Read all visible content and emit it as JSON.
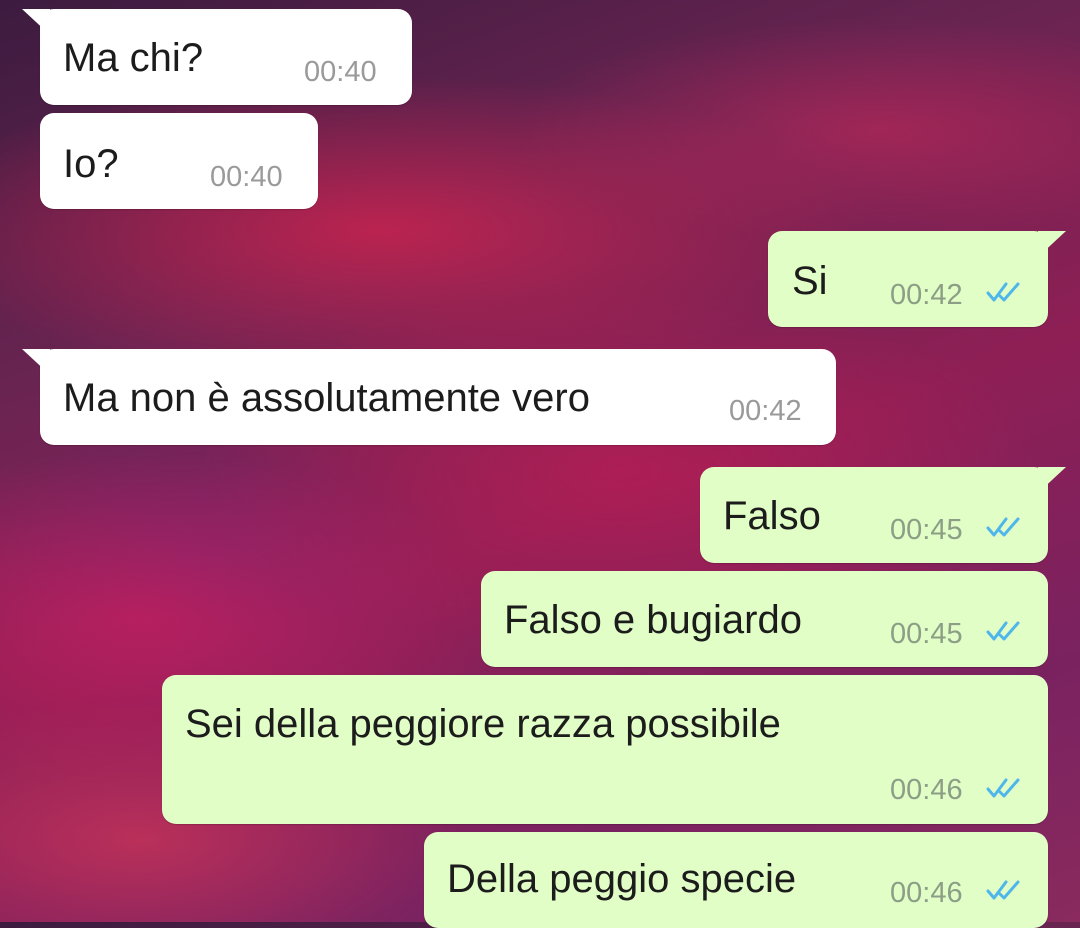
{
  "messages": [
    {
      "direction": "incoming",
      "text": "Ma chi?",
      "time": "00:40"
    },
    {
      "direction": "incoming",
      "text": "Io?",
      "time": "00:40"
    },
    {
      "direction": "outgoing",
      "text": "Si",
      "time": "00:42",
      "status": "read"
    },
    {
      "direction": "incoming",
      "text": "Ma non è assolutamente vero",
      "time": "00:42"
    },
    {
      "direction": "outgoing",
      "text": "Falso",
      "time": "00:45",
      "status": "read"
    },
    {
      "direction": "outgoing",
      "text": "Falso e bugiardo",
      "time": "00:45",
      "status": "read"
    },
    {
      "direction": "outgoing",
      "text": "Sei della peggiore razza possibile",
      "time": "00:46",
      "status": "read"
    },
    {
      "direction": "outgoing",
      "text": "Della peggio specie",
      "time": "00:46",
      "status": "read"
    }
  ],
  "colors": {
    "incoming_bubble": "#ffffff",
    "outgoing_bubble": "#e1fec6",
    "read_ticks": "#4fb6ec"
  },
  "icons": {
    "read_status": "double-check-icon"
  }
}
